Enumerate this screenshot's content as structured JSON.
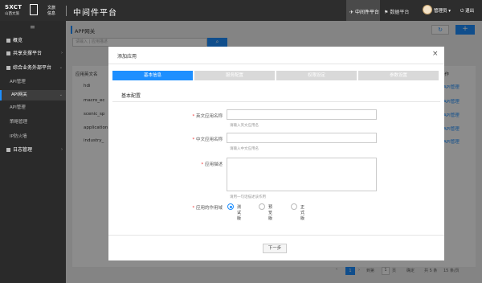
{
  "header": {
    "logo_brand": "SXCT",
    "logo_sub": "山西文旅",
    "logo_company_1": "文旅",
    "logo_company_2": "信息",
    "app_title": "中间件平台",
    "nav_middleware": "中间件平台",
    "nav_data": "数据平台",
    "user_name": "管理员",
    "logout": "退出"
  },
  "sidebar": {
    "toggle_icon": "≡",
    "items": [
      {
        "label": "概览"
      },
      {
        "label": "共享支撑平台"
      },
      {
        "label": "综合业务外部平台"
      },
      {
        "label": "API管理"
      },
      {
        "label": "API网关"
      },
      {
        "label": "API管理"
      },
      {
        "label": "策略管理"
      },
      {
        "label": "IP防火墙"
      },
      {
        "label": "日志管理"
      }
    ]
  },
  "page": {
    "title": "APP网关",
    "search_placeholder": "请输入 | 应用描述",
    "table_header_name": "应用英文名",
    "table_header_op": "操作",
    "rows": [
      {
        "name": "hdi",
        "op": "API管理"
      },
      {
        "name": "macro_ec",
        "op": "API管理"
      },
      {
        "name": "scenic_sp",
        "op": "API管理"
      },
      {
        "name": "application",
        "op": "API管理"
      },
      {
        "name": "industry_",
        "op": "API管理"
      }
    ],
    "pager": {
      "current_page": "1",
      "goto_label": "到第",
      "page_input": "1",
      "page_unit": "页",
      "confirm": "确定",
      "total": "共 5 条",
      "page_size": "15 条/页"
    }
  },
  "modal": {
    "title": "添加应用",
    "steps": [
      "基本信息",
      "服务配置",
      "权限设定",
      "参数设置"
    ],
    "section_title": "基本配置",
    "fields": {
      "en_name_label": "英文应用名称",
      "en_name_hint": "请输入英文应用名",
      "cn_name_label": "中文应用名称",
      "cn_name_hint": "请输入中文应用名",
      "desc_label": "应用描述",
      "desc_hint": "请用一句话描述该作用",
      "scope_label": "应用的作用域",
      "scope_options": [
        "测试版",
        "预览版",
        "正式版"
      ],
      "scope_selected": "测试版"
    },
    "next_button": "下一步"
  },
  "colors": {
    "accent": "#1e8fff",
    "sidebar_bg": "#2a2a2a",
    "topbar_bg": "#2d2d2d",
    "required": "#e33333"
  }
}
